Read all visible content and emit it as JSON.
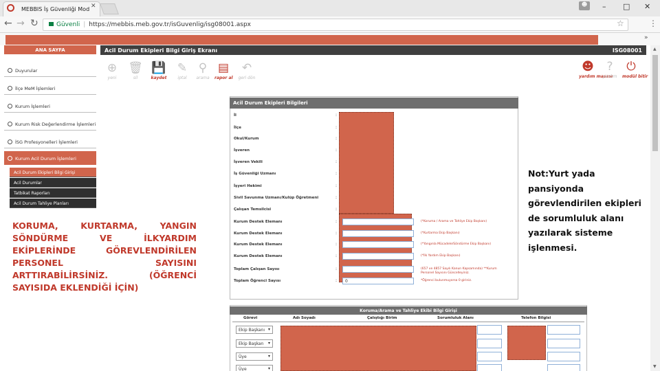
{
  "browser": {
    "tab_title": "MEBBIS İş Güvenliği Mod",
    "tab_close": "✕",
    "window_controls": [
      "–",
      "□",
      "✕"
    ],
    "nav": {
      "back": "←",
      "forward": "→",
      "reload": "↻"
    },
    "secure_label": "Güvenli",
    "url": "https://mebbis.meb.gov.tr/isGuvenlig/isg08001.aspx",
    "bookmark_more": "»",
    "menu_dots": "⋮",
    "star": "☆"
  },
  "header": {
    "sidebar_title": "ANA SAYFA",
    "page_title": "Acil Durum Ekipleri Bilgi Giriş Ekranı",
    "page_code": "ISG08001"
  },
  "toolbar": {
    "buttons": [
      {
        "id": "yeni",
        "label": "yeni",
        "icon": "plus-circle-icon",
        "glyph": "⊕",
        "active": false
      },
      {
        "id": "sil",
        "label": "sil",
        "icon": "trash-icon",
        "glyph": "🗑",
        "active": false
      },
      {
        "id": "kaydet",
        "label": "kaydet",
        "icon": "save-icon",
        "glyph": "💾",
        "active": true
      },
      {
        "id": "iptal",
        "label": "iptal",
        "icon": "cancel-icon",
        "glyph": "✎",
        "active": false
      },
      {
        "id": "arama",
        "label": "arama",
        "icon": "search-icon",
        "glyph": "⚲",
        "active": false
      },
      {
        "id": "raporal",
        "label": "rapor al",
        "icon": "report-icon",
        "glyph": "▤",
        "active": true
      },
      {
        "id": "geridon",
        "label": "geri dön",
        "icon": "back-icon",
        "glyph": "↶",
        "active": false
      }
    ],
    "right_buttons": [
      {
        "id": "yardim",
        "label": "yardım masası",
        "icon": "support-icon",
        "glyph": "☻",
        "active": true
      },
      {
        "id": "yardim2",
        "label": "yardım",
        "icon": "help-icon",
        "glyph": "?",
        "active": false
      },
      {
        "id": "cikis",
        "label": "modül bitir",
        "icon": "power-icon",
        "glyph": "⏻",
        "active": true
      }
    ]
  },
  "sidebar": {
    "items": [
      {
        "label": "Duyurular",
        "active": false
      },
      {
        "label": "İlçe MeM İşlemleri",
        "active": false
      },
      {
        "label": "Kurum İşlemleri",
        "active": false
      },
      {
        "label": "Kurum Risk Değerlendirme İşlemleri",
        "active": false
      },
      {
        "label": "İSG Profesyonelleri İşlemleri",
        "active": false
      },
      {
        "label": "Kurum Acil Durum İşlemleri",
        "active": true
      }
    ],
    "subitems": [
      {
        "label": "Acil Durum Ekipleri Bilgi Girişi",
        "active": true
      },
      {
        "label": "Acil Durumlar",
        "active": false
      },
      {
        "label": "Tatbikat Raporları",
        "active": false
      },
      {
        "label": "Acil Durum Tahliye Planları",
        "active": false
      }
    ]
  },
  "callouts": {
    "left": "KORUMA, KURTARMA, YANGIN SÖNDÜRME VE İLKYARDIM EKİPLERİNDE GÖREVLENDİRİLEN PERSONEL SAYISINI ARTTIRABİLİRSİNİZ. (ÖĞRENCİ SAYISIDA EKLENDİĞİ İÇİN)",
    "right": "Not:Yurt yada pansiyonda görevlendirilen ekipleri de sorumluluk alanı yazılarak sisteme işlenmesi."
  },
  "form": {
    "title": "Acil Durum Ekipleri Bilgileri",
    "colon": ":",
    "fields": [
      {
        "label": "İl"
      },
      {
        "label": "İlçe"
      },
      {
        "label": "Okul/Kurum"
      },
      {
        "label": "İşveren"
      },
      {
        "label": "İşveren Vekili"
      },
      {
        "label": "İş Güvenliği Uzmanı"
      },
      {
        "label": "İşyeri Hekimi"
      },
      {
        "label": "Sivil Savunma Uzmanı/Kulüp Öğretmeni"
      },
      {
        "label": "Çalışan Temsilcisi"
      },
      {
        "label": "Kurum Destek Elemanı",
        "value": "",
        "note": "(*Koruma / Arama ve Tahliye Ekip Başkanı)"
      },
      {
        "label": "Kurum Destek Elemanı",
        "value": "",
        "note": "(*Kurtarma Ekip Başkanı)"
      },
      {
        "label": "Kurum Destek Elemanı",
        "value": "",
        "note": "(*Yangınla Mücadele/Söndürme Ekip Başkanı)"
      },
      {
        "label": "Kurum Destek Elemanı",
        "value": "",
        "note": "(*İlk Yardım Ekip Başkanı)"
      },
      {
        "label": "Toplam Çalışan Sayısı",
        "value": "",
        "note": "(657 ve 4857 Sayılı Kanun Kapsamında) **Kurum Personel Sayısını Güncelleyiniz."
      },
      {
        "label": "Toplam Öğrenci Sayısı",
        "value": "0",
        "note": "*Öğrenci bulunmuyorsa 0 giriniz."
      }
    ]
  },
  "team_table": {
    "title": "Koruma/Arama ve Tahliye Ekibi Bilgi Girişi",
    "columns": [
      "Görevi",
      "Adı Soyadı",
      "Çalıştığı Birim",
      "Sorumluluk Alanı",
      "Telefon Bilgisi"
    ],
    "rows": [
      {
        "role": "Ekip Başkanı"
      },
      {
        "role": "Ekip Başkan"
      },
      {
        "role": "Üye"
      },
      {
        "role": "Üye"
      }
    ]
  },
  "colors": {
    "accent": "#d1654c",
    "header_dark": "#3f3f3f",
    "panel_head": "#6e6e6e"
  }
}
